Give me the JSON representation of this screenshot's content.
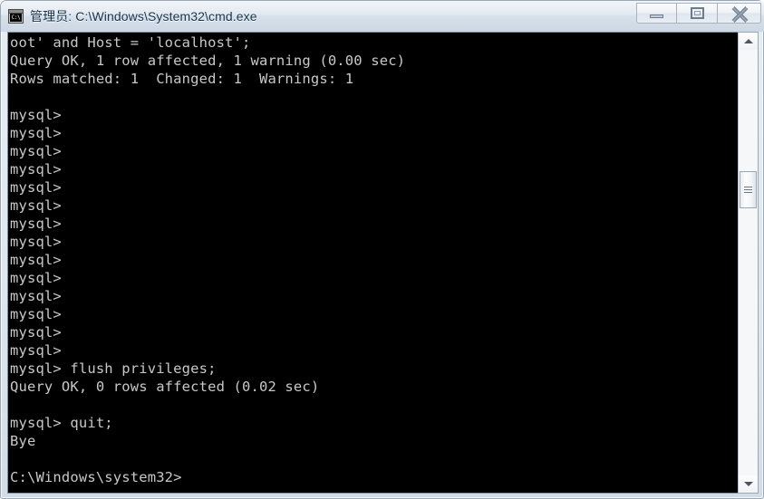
{
  "window": {
    "title": "管理员: C:\\Windows\\System32\\cmd.exe",
    "icon_name": "cmd-console-icon",
    "icon_text": "C:\\",
    "titlebar_color": "#dfe6ee",
    "console_background": "#000000",
    "console_foreground": "#c8c8c8"
  },
  "controls": {
    "minimize_label": "Minimize",
    "maximize_label": "Maximize",
    "close_label": "Close"
  },
  "scrollbar": {
    "up_label": "Scroll up",
    "down_label": "Scroll down",
    "thumb_label": "Scroll thumb"
  },
  "console": {
    "lines": [
      "oot' and Host = 'localhost';",
      "Query OK, 1 row affected, 1 warning (0.00 sec)",
      "Rows matched: 1  Changed: 1  Warnings: 1",
      "",
      "mysql>",
      "mysql>",
      "mysql>",
      "mysql>",
      "mysql>",
      "mysql>",
      "mysql>",
      "mysql>",
      "mysql>",
      "mysql>",
      "mysql>",
      "mysql>",
      "mysql>",
      "mysql>",
      "mysql> flush privileges;",
      "Query OK, 0 rows affected (0.02 sec)",
      "",
      "mysql> quit;",
      "Bye",
      "",
      "C:\\Windows\\system32>"
    ],
    "text": "oot' and Host = 'localhost';\nQuery OK, 1 row affected, 1 warning (0.00 sec)\nRows matched: 1  Changed: 1  Warnings: 1\n\nmysql>\nmysql>\nmysql>\nmysql>\nmysql>\nmysql>\nmysql>\nmysql>\nmysql>\nmysql>\nmysql>\nmysql>\nmysql>\nmysql>\nmysql> flush privileges;\nQuery OK, 0 rows affected (0.02 sec)\n\nmysql> quit;\nBye\n\nC:\\Windows\\system32>"
  }
}
